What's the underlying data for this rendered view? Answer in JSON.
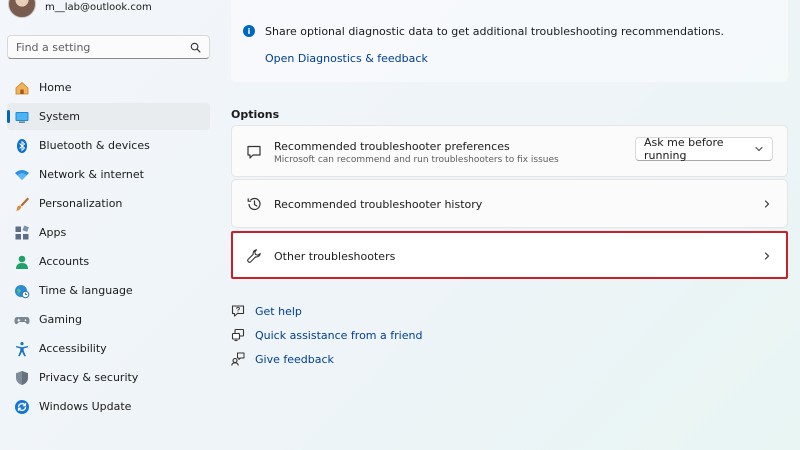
{
  "user": {
    "email": "m__lab@outlook.com"
  },
  "search": {
    "placeholder": "Find a setting"
  },
  "sidebar": {
    "items": [
      {
        "label": "Home",
        "icon": "home-icon"
      },
      {
        "label": "System",
        "icon": "system-icon",
        "selected": true
      },
      {
        "label": "Bluetooth & devices",
        "icon": "bluetooth-icon"
      },
      {
        "label": "Network & internet",
        "icon": "wifi-icon"
      },
      {
        "label": "Personalization",
        "icon": "brush-icon"
      },
      {
        "label": "Apps",
        "icon": "apps-icon"
      },
      {
        "label": "Accounts",
        "icon": "accounts-icon"
      },
      {
        "label": "Time & language",
        "icon": "globe-clock-icon"
      },
      {
        "label": "Gaming",
        "icon": "gamepad-icon"
      },
      {
        "label": "Accessibility",
        "icon": "accessibility-icon"
      },
      {
        "label": "Privacy & security",
        "icon": "shield-icon"
      },
      {
        "label": "Windows Update",
        "icon": "update-icon"
      }
    ]
  },
  "main": {
    "diagnostics": {
      "text": "Share optional diagnostic data to get additional troubleshooting recommendations.",
      "link": "Open Diagnostics & feedback"
    },
    "options_title": "Options",
    "preferences": {
      "title": "Recommended troubleshooter preferences",
      "subtitle": "Microsoft can recommend and run troubleshooters to fix issues",
      "dropdown_value": "Ask me before running"
    },
    "history": {
      "title": "Recommended troubleshooter history"
    },
    "other": {
      "title": "Other troubleshooters"
    },
    "links": [
      {
        "label": "Get help",
        "icon": "help-icon"
      },
      {
        "label": "Quick assistance from a friend",
        "icon": "quick-assist-icon"
      },
      {
        "label": "Give feedback",
        "icon": "feedback-icon"
      }
    ]
  },
  "colors": {
    "accent": "#0067c0",
    "link": "#003e92",
    "highlight": "#c8202b",
    "selected_bg": "#e9ecef"
  }
}
